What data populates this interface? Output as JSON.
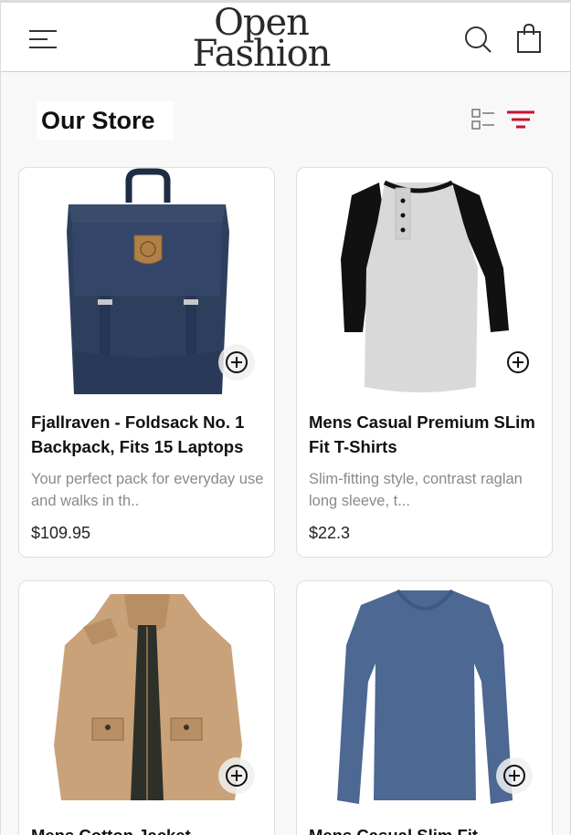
{
  "header": {
    "logo_line1": "Open",
    "logo_line2": "Fashion"
  },
  "store": {
    "title": "Our Store"
  },
  "colors": {
    "accent_red": "#c8102e",
    "text_dark": "#111111",
    "text_muted": "#8a8a8a"
  },
  "products": [
    {
      "title": "Fjallraven - Foldsack No. 1 Backpack, Fits 15 Laptops",
      "description": "Your perfect pack for everyday use and walks in th..",
      "price": "$109.95",
      "image": "backpack"
    },
    {
      "title": "Mens Casual Premium SLim Fit T-Shirts",
      "description": "Slim-fitting style, contrast raglan long sleeve, t...",
      "price": "$22.3",
      "image": "raglan-tshirt"
    },
    {
      "title": "Mens Cotton Jacket",
      "description": "",
      "price": "",
      "image": "jacket"
    },
    {
      "title": "Mens Casual Slim Fit",
      "description": "",
      "price": "",
      "image": "longsleeve-tshirt"
    }
  ],
  "icons": {
    "menu": "menu-icon",
    "search": "search-icon",
    "bag": "shopping-bag-icon",
    "grid": "grid-view-icon",
    "filter": "filter-icon",
    "add": "add-circle-icon"
  }
}
